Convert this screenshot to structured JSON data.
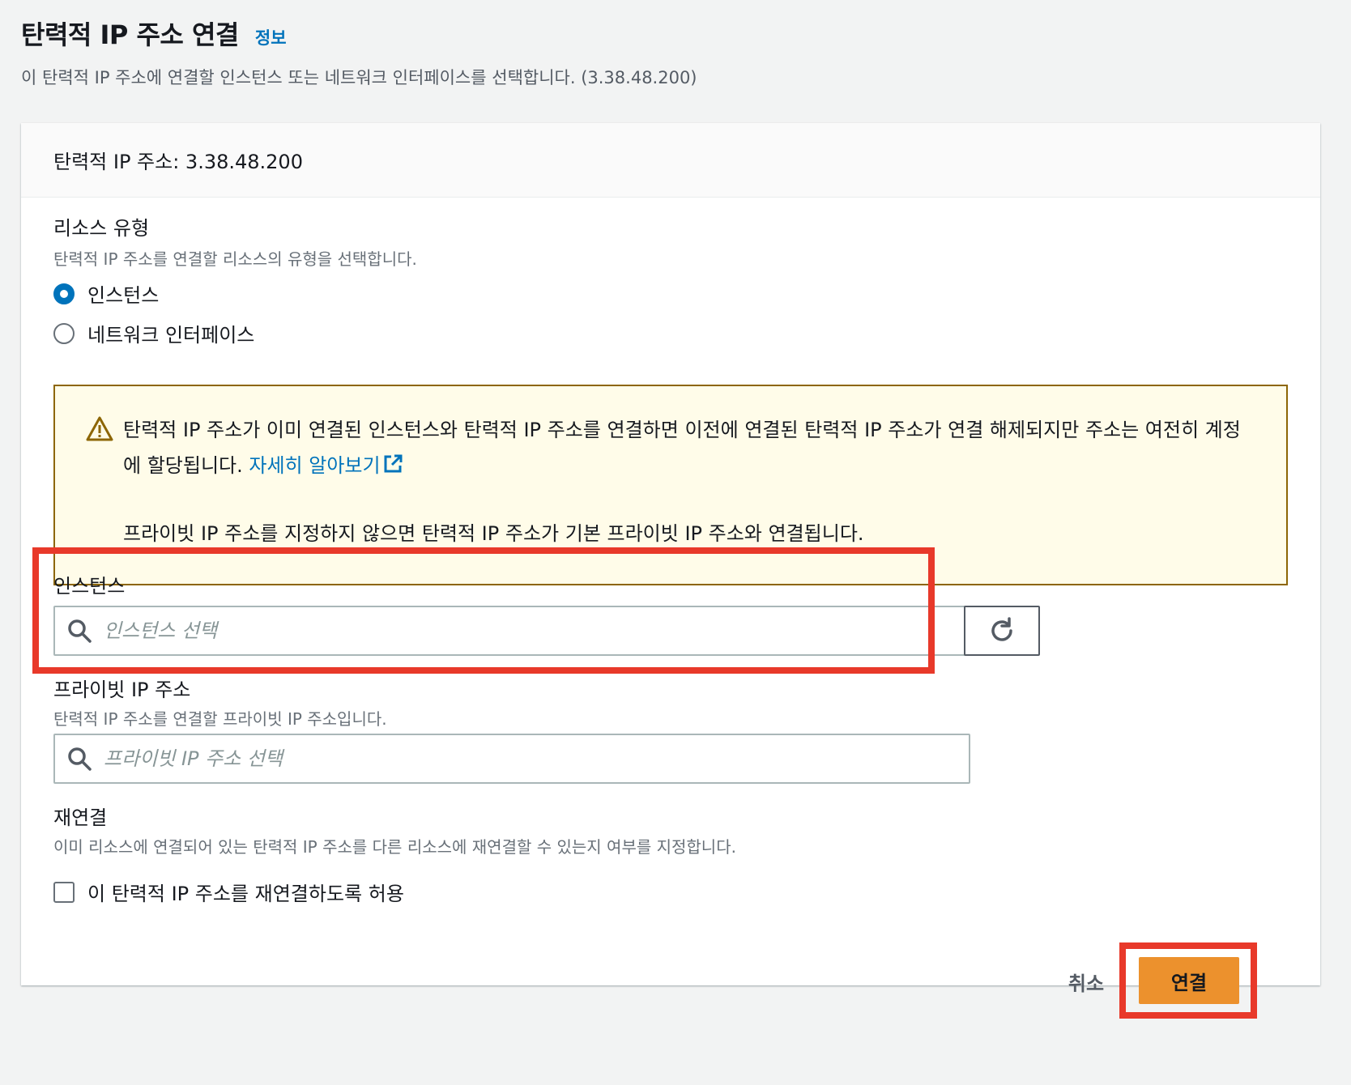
{
  "header": {
    "title": "탄력적 IP 주소 연결",
    "info_link": "정보",
    "description": "이 탄력적 IP 주소에 연결할 인스턴스 또는 네트워크 인터페이스를 선택합니다. (3.38.48.200)"
  },
  "panel": {
    "heading": "탄력적 IP 주소: 3.38.48.200",
    "resource_type": {
      "label": "리소스 유형",
      "description": "탄력적 IP 주소를 연결할 리소스의 유형을 선택합니다.",
      "options": [
        {
          "label": "인스턴스",
          "selected": true
        },
        {
          "label": "네트워크 인터페이스",
          "selected": false
        }
      ]
    },
    "alert": {
      "icon": "warning-icon",
      "line1": "탄력적 IP 주소가 이미 연결된 인스턴스와 탄력적 IP 주소를 연결하면 이전에 연결된 탄력적 IP 주소가 연결 해제되지만 주소는 여전히 계정에 할당됩니다.",
      "link": "자세히 알아보기",
      "line2": "프라이빗 IP 주소를 지정하지 않으면 탄력적 IP 주소가 기본 프라이빗 IP 주소와 연결됩니다."
    },
    "instance": {
      "label": "인스턴스",
      "placeholder": "인스턴스 선택",
      "value": ""
    },
    "private_ip": {
      "label": "프라이빗 IP 주소",
      "description": "탄력적 IP 주소를 연결할 프라이빗 IP 주소입니다.",
      "placeholder": "프라이빗 IP 주소 선택",
      "value": ""
    },
    "reassociation": {
      "label": "재연결",
      "description": "이미 리소스에 연결되어 있는 탄력적 IP 주소를 다른 리소스에 재연결할 수 있는지 여부를 지정합니다.",
      "checkbox_label": "이 탄력적 IP 주소를 재연결하도록 허용",
      "checked": false
    }
  },
  "footer": {
    "cancel_label": "취소",
    "submit_label": "연결"
  },
  "colors": {
    "accent": "#0073bb",
    "primary_button": "#ec912d",
    "warning_border": "#8d6605",
    "warning_bg": "#fffce9",
    "highlight": "#e8392a"
  }
}
